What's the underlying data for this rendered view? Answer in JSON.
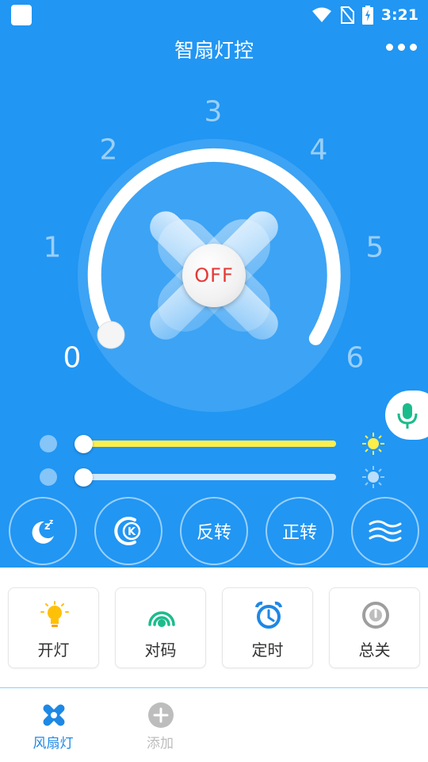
{
  "status_bar": {
    "time": "3:21",
    "icons": [
      "app-square-icon",
      "wifi-icon",
      "no-sim-icon",
      "battery-charging-icon"
    ]
  },
  "header": {
    "title": "智扇灯控",
    "more_icon": "more-dots-icon"
  },
  "speed_dial": {
    "levels": [
      "0",
      "1",
      "2",
      "3",
      "4",
      "5",
      "6"
    ],
    "current_level": 0,
    "power_label": "OFF",
    "fan_icon": "fan-blades-icon"
  },
  "voice": {
    "icon": "microphone-icon",
    "color": "#1bbc8c"
  },
  "sliders": {
    "brightness": {
      "value_fraction": 0.0,
      "fill_color": "#fdee4a",
      "icon": "sun-yellow-icon"
    },
    "color_temp": {
      "value_fraction": 0.0,
      "fill_color": "#ffffff",
      "icon": "sun-blue-icon"
    }
  },
  "modes": [
    {
      "name": "sleep",
      "label": "",
      "icon": "sleep-moon-icon"
    },
    {
      "name": "k",
      "label": "",
      "icon": "k-mode-icon"
    },
    {
      "name": "reverse",
      "label": "反转",
      "icon": ""
    },
    {
      "name": "forward",
      "label": "正转",
      "icon": ""
    },
    {
      "name": "natural-wind",
      "label": "",
      "icon": "wind-waves-icon"
    }
  ],
  "actions": [
    {
      "label": "开灯",
      "icon": "light-bulb-icon",
      "color": "#ffc107"
    },
    {
      "label": "对码",
      "icon": "signal-pairing-icon",
      "color": "#1bbc8c"
    },
    {
      "label": "定时",
      "icon": "alarm-clock-icon",
      "color": "#1e88e5"
    },
    {
      "label": "总关",
      "icon": "power-icon",
      "color": "#9e9e9e"
    }
  ],
  "bottom_nav": [
    {
      "label": "风扇灯",
      "icon": "fan-nav-icon",
      "active": true,
      "color": "#1e88e5"
    },
    {
      "label": "添加",
      "icon": "add-circle-icon",
      "active": false,
      "color": "#bdbdbd"
    }
  ],
  "colors": {
    "primary": "#2196f3",
    "off_text": "#e53935"
  }
}
